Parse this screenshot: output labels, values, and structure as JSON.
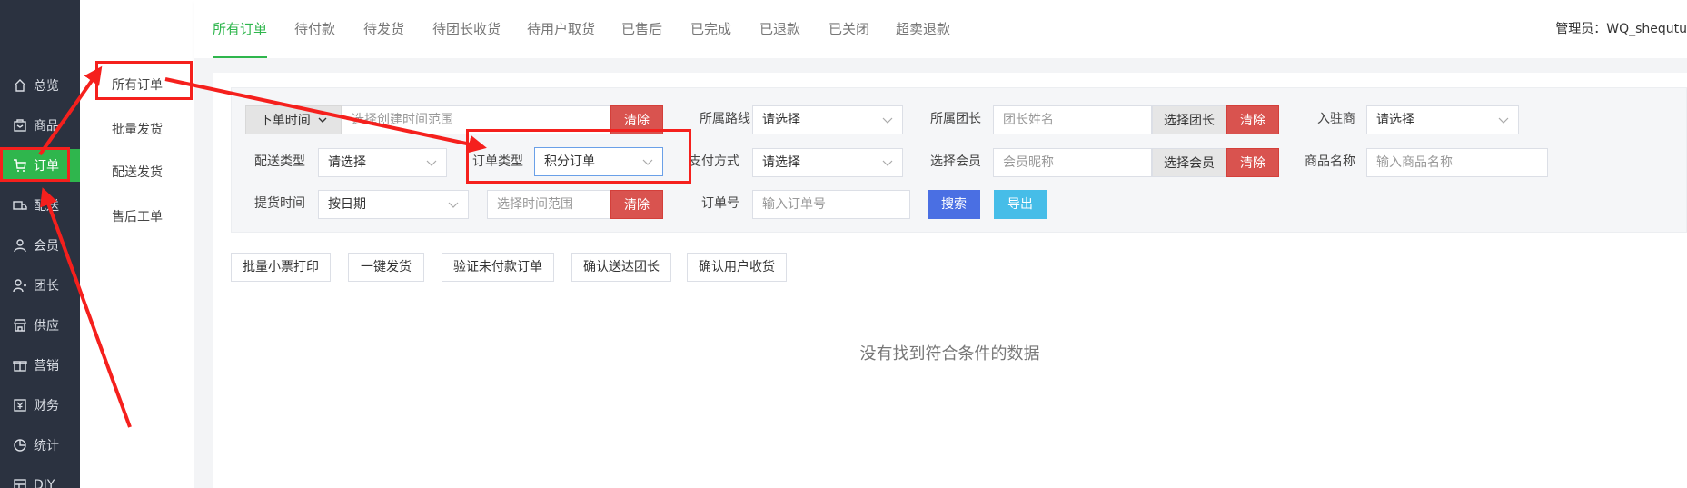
{
  "sidebar": {
    "items": [
      {
        "label": "总览",
        "icon": "home-icon"
      },
      {
        "label": "商品",
        "icon": "goods-icon"
      },
      {
        "label": "订单",
        "icon": "cart-icon",
        "active": true
      },
      {
        "label": "配送",
        "icon": "delivery-icon"
      },
      {
        "label": "会员",
        "icon": "user-icon"
      },
      {
        "label": "团长",
        "icon": "leader-icon"
      },
      {
        "label": "供应",
        "icon": "store-icon"
      },
      {
        "label": "营销",
        "icon": "gift-icon"
      },
      {
        "label": "财务",
        "icon": "finance-icon"
      },
      {
        "label": "统计",
        "icon": "chart-icon"
      },
      {
        "label": "DIY",
        "icon": "diy-icon"
      }
    ]
  },
  "submenu": {
    "items": [
      "所有订单",
      "批量发货",
      "配送发货",
      "售后工单"
    ]
  },
  "tabs": [
    "所有订单",
    "待付款",
    "待发货",
    "待团长收货",
    "待用户取货",
    "已售后",
    "已完成",
    "已退款",
    "已关闭",
    "超卖退款"
  ],
  "header": {
    "admin_label": "管理员：",
    "admin_name": "WQ_shequtu"
  },
  "filters": {
    "order_time_label": "下单时间",
    "order_time_placeholder": "选择创建时间范围",
    "clear_label": "清除",
    "route_label": "所属路线",
    "select_placeholder": "请选择",
    "leader_label": "所属团长",
    "leader_placeholder": "团长姓名",
    "choose_leader": "选择团长",
    "merchant_label": "入驻商",
    "delivery_type_label": "配送类型",
    "order_type_label": "订单类型",
    "order_type_value": "积分订单",
    "pay_method_label": "支付方式",
    "member_label": "选择会员",
    "member_placeholder": "会员昵称",
    "choose_member": "选择会员",
    "goods_name_label": "商品名称",
    "goods_name_placeholder": "输入商品名称",
    "pickup_time_label": "提货时间",
    "pickup_time_value": "按日期",
    "time_range_placeholder": "选择时间范围",
    "order_no_label": "订单号",
    "order_no_placeholder": "输入订单号",
    "search_label": "搜索",
    "export_label": "导出"
  },
  "actions": [
    "批量小票打印",
    "一键发货",
    "验证未付款订单",
    "确认送达团长",
    "确认用户收货"
  ],
  "empty_text": "没有找到符合条件的数据",
  "colors": {
    "accent": "#2fb64d",
    "danger": "#d9534f",
    "primary": "#4a6fe3",
    "info": "#46bde8",
    "annotation": "#f5201d"
  }
}
